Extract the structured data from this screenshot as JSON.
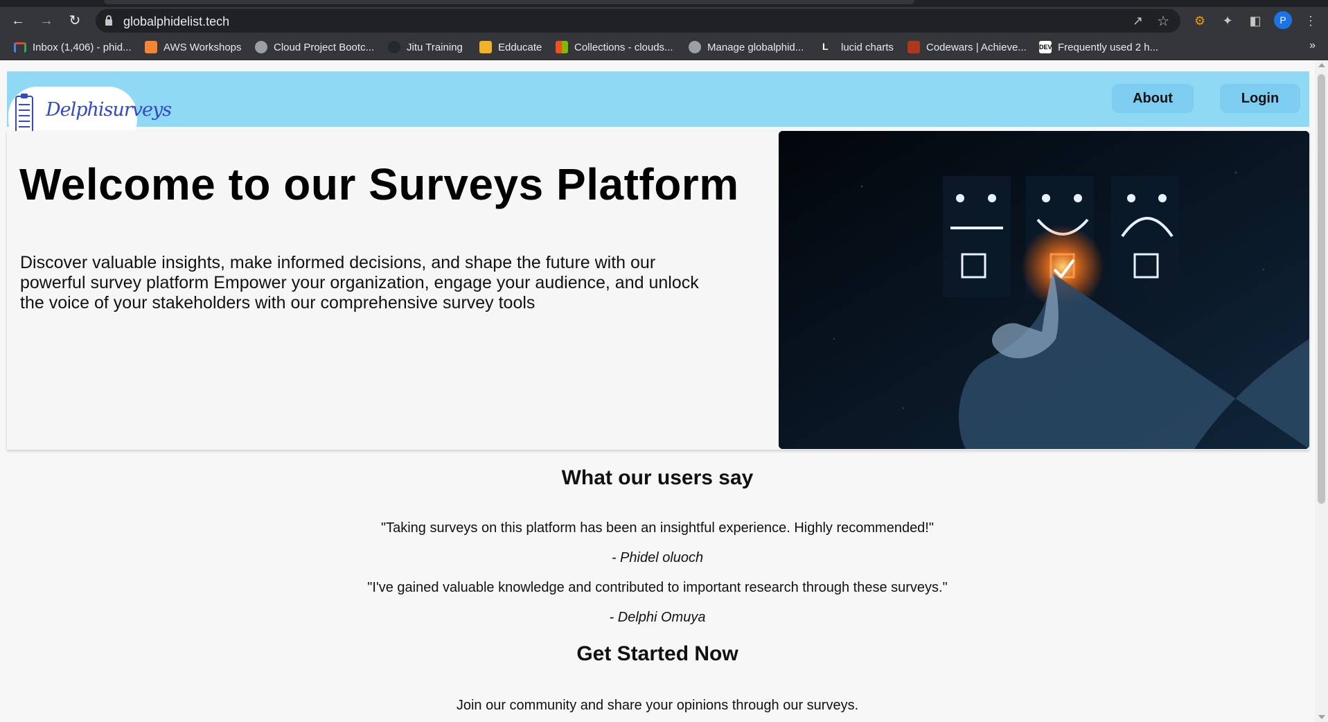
{
  "browser": {
    "url": "globalphidelist.tech",
    "profile_initial": "P",
    "bookmarks": [
      {
        "label": "Inbox (1,406) - phid...",
        "icon": "gmail-icon",
        "color": "#ea4335"
      },
      {
        "label": "AWS Workshops",
        "icon": "aws-icon",
        "color": "#f58536"
      },
      {
        "label": "Cloud Project Bootc...",
        "icon": "globe-icon",
        "color": "#9aa0a6"
      },
      {
        "label": "Jitu Training",
        "icon": "github-icon",
        "color": "#24292f"
      },
      {
        "label": "Edducate",
        "icon": "box-icon",
        "color": "#f0b429"
      },
      {
        "label": "Collections - clouds...",
        "icon": "microsoft-icon",
        "color": "#00a4ef"
      },
      {
        "label": "Manage globalphid...",
        "icon": "globe-icon",
        "color": "#9aa0a6"
      },
      {
        "label": "lucid charts",
        "icon": "lucid-icon",
        "color": "#ffffff"
      },
      {
        "label": "Codewars | Achieve...",
        "icon": "codewars-icon",
        "color": "#b1361e"
      },
      {
        "label": "Frequently used 2 h...",
        "icon": "dev-icon",
        "color": "#ffffff"
      }
    ],
    "more_bookmarks": "»"
  },
  "site": {
    "brand": "Delphisurveys",
    "nav": {
      "about": "About",
      "login": "Login"
    },
    "hero": {
      "title": "Welcome to our Surveys Platform",
      "text": "Discover valuable insights, make informed decisions, and shape the future with our powerful survey platform Empower your organization, engage your audience, and unlock the voice of your stakeholders with our comprehensive survey tools"
    },
    "testimonials": {
      "heading": "What our users say",
      "items": [
        {
          "quote": "\"Taking surveys on this platform has been an insightful experience. Highly recommended!\"",
          "author": "- Phidel oluoch"
        },
        {
          "quote": "\"I've gained valuable knowledge and contributed to important research through these surveys.\"",
          "author": "- Delphi Omuya"
        }
      ]
    },
    "cta": {
      "heading": "Get Started Now",
      "text": "Join our community and share your opinions through our surveys."
    }
  },
  "colors": {
    "navbar": "#8fd9f5",
    "nav_button": "#7ccdf0",
    "brand": "#3148c8"
  }
}
